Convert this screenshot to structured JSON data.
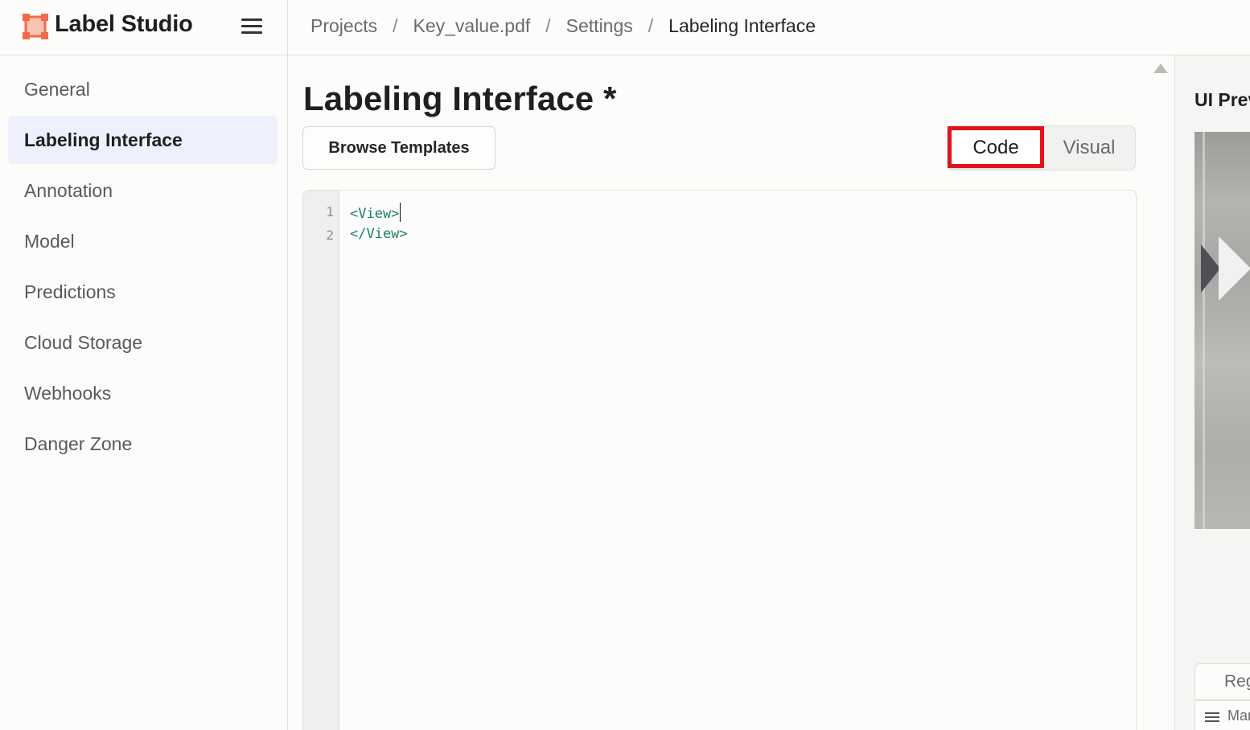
{
  "app": {
    "name": "Label Studio",
    "brand_color": "#f26a4b"
  },
  "breadcrumb": [
    "Projects",
    "Key_value.pdf",
    "Settings",
    "Labeling Interface"
  ],
  "sidebar": {
    "items": [
      {
        "label": "General"
      },
      {
        "label": "Labeling Interface",
        "active": true
      },
      {
        "label": "Annotation"
      },
      {
        "label": "Model"
      },
      {
        "label": "Predictions"
      },
      {
        "label": "Cloud Storage"
      },
      {
        "label": "Webhooks"
      },
      {
        "label": "Danger Zone"
      }
    ]
  },
  "main": {
    "title": "Labeling Interface *",
    "browse_templates": "Browse Templates",
    "toggle": {
      "code": "Code",
      "visual": "Visual",
      "selected": "Code"
    },
    "editor": {
      "lines": [
        {
          "no": "1",
          "text": "<View>"
        },
        {
          "no": "2",
          "text": "</View>"
        }
      ]
    }
  },
  "preview": {
    "title": "UI Preview",
    "tab_label": "Regions",
    "row_label": "Manual"
  },
  "highlight_color": "#e0141b"
}
